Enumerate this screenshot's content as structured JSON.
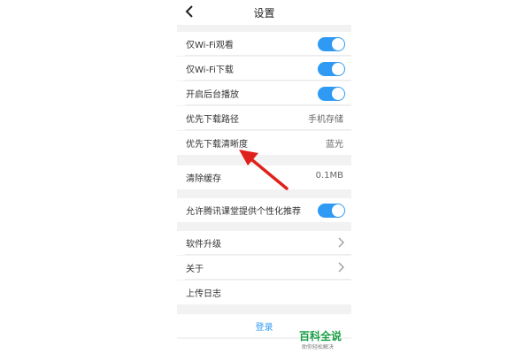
{
  "header": {
    "title": "设置"
  },
  "settings": {
    "wifi_watch": "仅Wi-Fi观看",
    "wifi_download": "仅Wi-Fi下载",
    "background_play": "开启后台播放",
    "download_path_label": "优先下载路径",
    "download_path_value": "手机存储",
    "download_quality_label": "优先下载清晰度",
    "download_quality_value": "蓝光",
    "clear_cache_label": "清除缓存",
    "clear_cache_value": "0.1MB",
    "personalized_recommend": "允许腾讯课堂提供个性化推荐",
    "upgrade": "软件升级",
    "about": "关于",
    "upload_log": "上传日志"
  },
  "login": {
    "label": "登录"
  },
  "watermark": {
    "title": "百科全说",
    "subtitle": "助你轻松解决"
  },
  "colors": {
    "toggle_on": "#2f9af3",
    "annotation_arrow": "#e0201b",
    "watermark_green": "#1a9e46"
  }
}
